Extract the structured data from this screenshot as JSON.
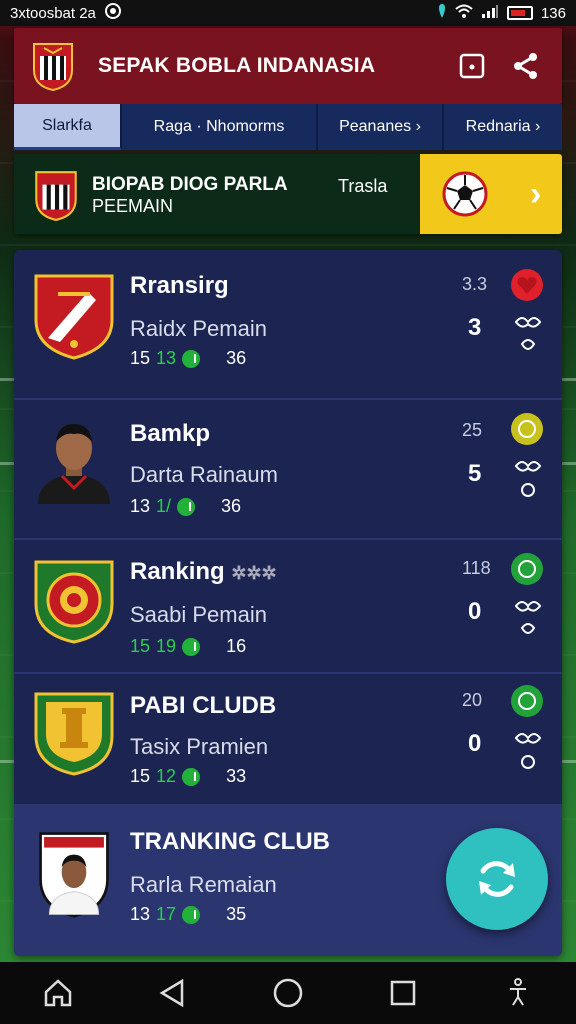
{
  "status_bar": {
    "left_text": "3xtoosbat 2a",
    "time": "136"
  },
  "app_bar": {
    "title": "SEPAK BOBLA INDANASIA",
    "actions": [
      "square-icon",
      "share-icon"
    ]
  },
  "tabs": [
    {
      "label": "Slarkfa",
      "active": true
    },
    {
      "label": "Raga ·  Nhomorms",
      "active": false
    },
    {
      "label": "Peananes ›",
      "active": false
    },
    {
      "label": "Rednaria ›",
      "active": false
    }
  ],
  "banner": {
    "title": "BIOPAB DIOG PARLA",
    "subtitle": "PEEMAIN",
    "tag": "Trasla",
    "arrow": "›"
  },
  "rows": [
    {
      "name": "Rransirg",
      "sub": "Raidx Pemain",
      "stat_a": "15",
      "stat_b": "13",
      "stat_c": "36",
      "small": "3.3",
      "score": "3",
      "badge_color": "#e0202a"
    },
    {
      "name": "Bamkp",
      "sub": "Darta Rainaum",
      "stat_a": "13",
      "stat_b": "1/",
      "stat_c": "36",
      "small": "25",
      "score": "5",
      "badge_color": "#c8c21c"
    },
    {
      "name": "Ranking",
      "name_extra": "✲✲✲",
      "sub": "Saabi Pemain",
      "stat_a": "15",
      "stat_b": "19",
      "stat_c": "16",
      "small": "118",
      "score": "0",
      "badge_color": "#22a33a"
    },
    {
      "name": "PABI CLUDB",
      "sub": "Tasix Pramien",
      "stat_a": "15",
      "stat_b": "12",
      "stat_c": "33",
      "small": "20",
      "score": "0",
      "badge_color": "#22a33a"
    },
    {
      "name": "TRANKING CLUB",
      "sub": "Rarla Remaian",
      "stat_a": "13",
      "stat_b": "17",
      "stat_c": "35",
      "small": "",
      "score": "",
      "badge_color": ""
    }
  ],
  "nav": [
    "home-icon",
    "back-icon",
    "circle-home-icon",
    "recents-icon",
    "accessibility-icon"
  ]
}
